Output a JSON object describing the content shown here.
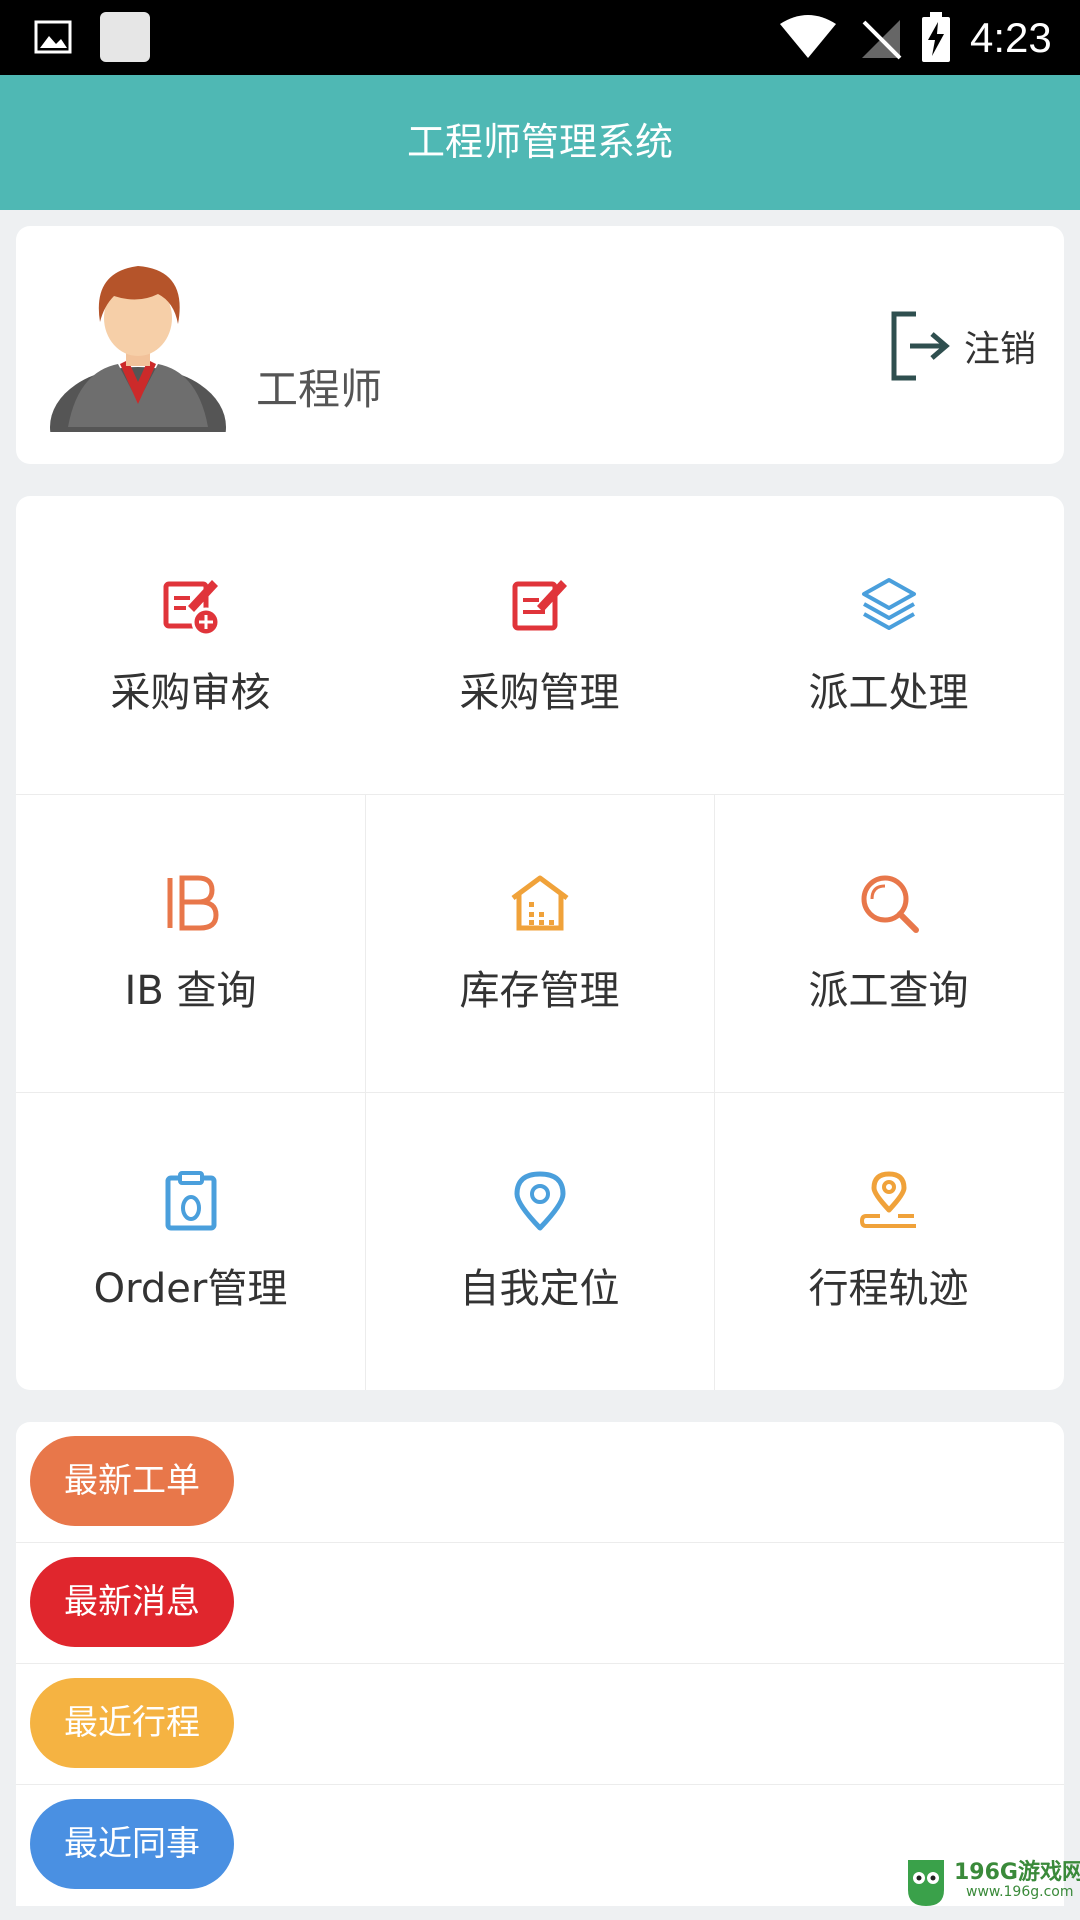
{
  "status_bar": {
    "time": "4:23",
    "icons": [
      "gallery-icon",
      "notification-square-icon",
      "wifi-icon",
      "no-signal-icon",
      "battery-charging-icon"
    ]
  },
  "header": {
    "title": "工程师管理系统",
    "bg_color": "#4fb8b4"
  },
  "profile": {
    "role": "工程师",
    "logout_label": "注销"
  },
  "menu": [
    {
      "label": "采购审核",
      "icon": "edit-add-icon",
      "color": "#e0343a"
    },
    {
      "label": "采购管理",
      "icon": "edit-icon",
      "color": "#e0343a"
    },
    {
      "label": "派工处理",
      "icon": "layers-icon",
      "color": "#4a9fdc"
    },
    {
      "label": "IB 查询",
      "icon": "ib-icon",
      "color": "#e8774a"
    },
    {
      "label": "库存管理",
      "icon": "warehouse-icon",
      "color": "#f0a23a"
    },
    {
      "label": "派工查询",
      "icon": "search-icon",
      "color": "#e8774a"
    },
    {
      "label": "Order管理",
      "icon": "clipboard-icon",
      "color": "#4a9fdc"
    },
    {
      "label": "自我定位",
      "icon": "location-pin-icon",
      "color": "#4a9fdc"
    },
    {
      "label": "行程轨迹",
      "icon": "route-pin-icon",
      "color": "#f0a23a"
    }
  ],
  "feeds": [
    {
      "label": "最新工单",
      "color": "#e8774a"
    },
    {
      "label": "最新消息",
      "color": "#e0262d"
    },
    {
      "label": "最近行程",
      "color": "#f5b342"
    },
    {
      "label": "最近同事",
      "color": "#4a90e2"
    }
  ],
  "watermark": {
    "title": "196G游戏网",
    "url": "www.196g.com"
  }
}
